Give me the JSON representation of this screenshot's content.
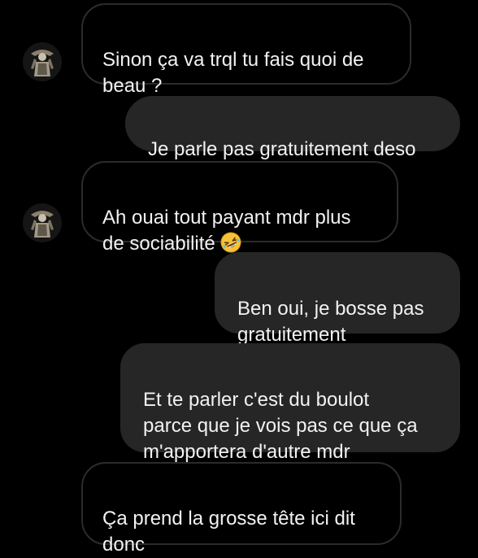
{
  "colors": {
    "background": "#000000",
    "received_bubble_border": "#2b2b2b",
    "sent_bubble_fill": "#262626",
    "text": "#f2f2f2"
  },
  "messages": [
    {
      "direction": "received",
      "text": "Sinon ça va trql tu fais quoi de\nbeau ?",
      "avatar_icon": "contact-avatar-icon"
    },
    {
      "direction": "sent",
      "text": "Je parle pas gratuitement deso"
    },
    {
      "direction": "received",
      "text": "Ah ouai tout payant mdr plus\nde sociabilité",
      "emoji_icon": "rolling-on-floor-laughing-emoji-icon",
      "avatar_icon": "contact-avatar-icon"
    },
    {
      "direction": "sent",
      "text": "Ben oui, je bosse pas\ngratuitement"
    },
    {
      "direction": "sent",
      "text": "Et te parler c'est du boulot\nparce que je vois pas ce que ça\nm'apportera d'autre mdr"
    },
    {
      "direction": "received",
      "text": "Ça prend la grosse tête ici dit\ndonc"
    }
  ]
}
